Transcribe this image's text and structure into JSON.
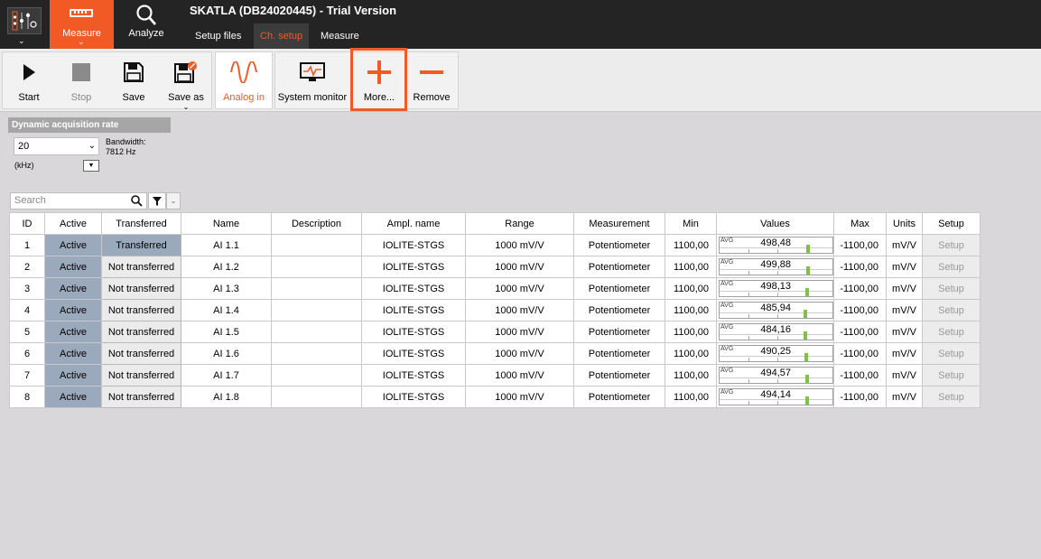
{
  "window": {
    "title": "SKATLA (DB24020445) - Trial Version"
  },
  "modes": {
    "measure_label": "Measure",
    "analyze_label": "Analyze"
  },
  "subtabs": [
    {
      "label": "Setup files",
      "active": false
    },
    {
      "label": "Ch. setup",
      "active": true
    },
    {
      "label": "Measure",
      "active": false
    }
  ],
  "toolbar": {
    "start_label": "Start",
    "stop_label": "Stop",
    "save_label": "Save",
    "save_as_label": "Save as",
    "analog_in_label": "Analog in",
    "system_monitor_label": "System monitor",
    "more_label": "More...",
    "remove_label": "Remove"
  },
  "acquisition": {
    "header": "Dynamic acquisition rate",
    "rate_value": "20",
    "bandwidth_label": "Bandwidth:",
    "bandwidth_value": "7812 Hz",
    "unit_label": "(kHz)"
  },
  "search": {
    "placeholder": "Search"
  },
  "table": {
    "columns": [
      "ID",
      "Active",
      "Transferred",
      "Name",
      "Description",
      "Ampl. name",
      "Range",
      "Measurement",
      "Min",
      "Values",
      "Max",
      "Units",
      "Setup"
    ],
    "rows": [
      {
        "id": "1",
        "active": "Active",
        "transferred": "Transferred",
        "transferred_state": true,
        "name": "AI 1.1",
        "description": "",
        "ampl_name": "IOLITE-STGS",
        "range": "1000 mV/V",
        "measurement": "Potentiometer",
        "min": "1100,00",
        "avg_label": "AVG",
        "value": "498,48",
        "max": "-1100,00",
        "units": "mV/V",
        "setup": "Setup"
      },
      {
        "id": "2",
        "active": "Active",
        "transferred": "Not transferred",
        "transferred_state": false,
        "name": "AI 1.2",
        "description": "",
        "ampl_name": "IOLITE-STGS",
        "range": "1000 mV/V",
        "measurement": "Potentiometer",
        "min": "1100,00",
        "avg_label": "AVG",
        "value": "499,88",
        "max": "-1100,00",
        "units": "mV/V",
        "setup": "Setup"
      },
      {
        "id": "3",
        "active": "Active",
        "transferred": "Not transferred",
        "transferred_state": false,
        "name": "AI 1.3",
        "description": "",
        "ampl_name": "IOLITE-STGS",
        "range": "1000 mV/V",
        "measurement": "Potentiometer",
        "min": "1100,00",
        "avg_label": "AVG",
        "value": "498,13",
        "max": "-1100,00",
        "units": "mV/V",
        "setup": "Setup"
      },
      {
        "id": "4",
        "active": "Active",
        "transferred": "Not transferred",
        "transferred_state": false,
        "name": "AI 1.4",
        "description": "",
        "ampl_name": "IOLITE-STGS",
        "range": "1000 mV/V",
        "measurement": "Potentiometer",
        "min": "1100,00",
        "avg_label": "AVG",
        "value": "485,94",
        "max": "-1100,00",
        "units": "mV/V",
        "setup": "Setup"
      },
      {
        "id": "5",
        "active": "Active",
        "transferred": "Not transferred",
        "transferred_state": false,
        "name": "AI 1.5",
        "description": "",
        "ampl_name": "IOLITE-STGS",
        "range": "1000 mV/V",
        "measurement": "Potentiometer",
        "min": "1100,00",
        "avg_label": "AVG",
        "value": "484,16",
        "max": "-1100,00",
        "units": "mV/V",
        "setup": "Setup"
      },
      {
        "id": "6",
        "active": "Active",
        "transferred": "Not transferred",
        "transferred_state": false,
        "name": "AI 1.6",
        "description": "",
        "ampl_name": "IOLITE-STGS",
        "range": "1000 mV/V",
        "measurement": "Potentiometer",
        "min": "1100,00",
        "avg_label": "AVG",
        "value": "490,25",
        "max": "-1100,00",
        "units": "mV/V",
        "setup": "Setup"
      },
      {
        "id": "7",
        "active": "Active",
        "transferred": "Not transferred",
        "transferred_state": false,
        "name": "AI 1.7",
        "description": "",
        "ampl_name": "IOLITE-STGS",
        "range": "1000 mV/V",
        "measurement": "Potentiometer",
        "min": "1100,00",
        "avg_label": "AVG",
        "value": "494,57",
        "max": "-1100,00",
        "units": "mV/V",
        "setup": "Setup"
      },
      {
        "id": "8",
        "active": "Active",
        "transferred": "Not transferred",
        "transferred_state": false,
        "name": "AI 1.8",
        "description": "",
        "ampl_name": "IOLITE-STGS",
        "range": "1000 mV/V",
        "measurement": "Potentiometer",
        "min": "1100,00",
        "avg_label": "AVG",
        "value": "494,14",
        "max": "-1100,00",
        "units": "mV/V",
        "setup": "Setup"
      }
    ]
  },
  "colors": {
    "accent": "#f15a24",
    "topbar": "#242424",
    "active_cell": "#9ba9bd",
    "value_bar": "#7dc242"
  }
}
